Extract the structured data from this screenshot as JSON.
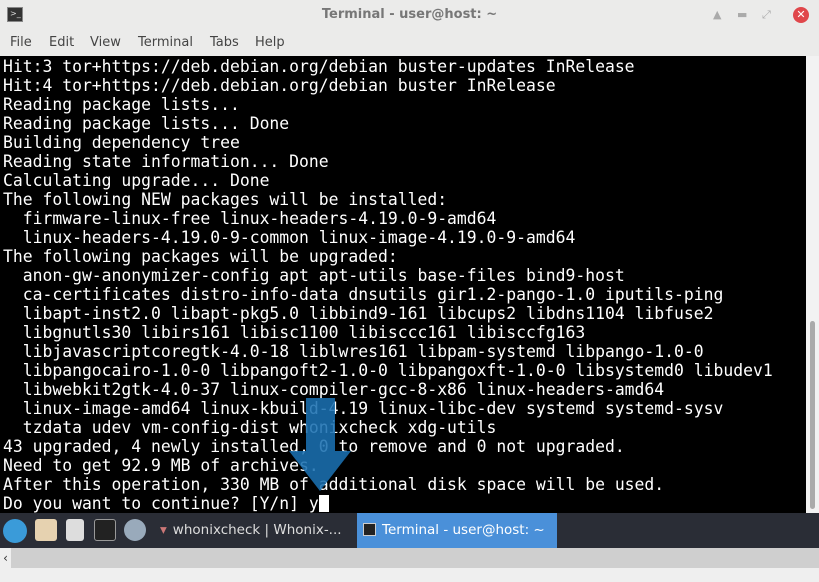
{
  "window": {
    "title": "Terminal - user@host: ~"
  },
  "menu": [
    "File",
    "Edit",
    "View",
    "Terminal",
    "Tabs",
    "Help"
  ],
  "terminal": {
    "lines": [
      "Hit:3 tor+https://deb.debian.org/debian buster-updates InRelease",
      "Hit:4 tor+https://deb.debian.org/debian buster InRelease",
      "Reading package lists...",
      "Reading package lists... Done",
      "Building dependency tree",
      "Reading state information... Done",
      "Calculating upgrade... Done",
      "The following NEW packages will be installed:",
      "  firmware-linux-free linux-headers-4.19.0-9-amd64",
      "  linux-headers-4.19.0-9-common linux-image-4.19.0-9-amd64",
      "The following packages will be upgraded:",
      "  anon-gw-anonymizer-config apt apt-utils base-files bind9-host",
      "  ca-certificates distro-info-data dnsutils gir1.2-pango-1.0 iputils-ping",
      "  libapt-inst2.0 libapt-pkg5.0 libbind9-161 libcups2 libdns1104 libfuse2",
      "  libgnutls30 libirs161 libisc1100 libisccc161 libisccfg163",
      "  libjavascriptcoregtk-4.0-18 liblwres161 libpam-systemd libpango-1.0-0",
      "  libpangocairo-1.0-0 libpangoft2-1.0-0 libpangoxft-1.0-0 libsystemd0 libudev1",
      "  libwebkit2gtk-4.0-37 linux-compiler-gcc-8-x86 linux-headers-amd64",
      "  linux-image-amd64 linux-kbuild-4.19 linux-libc-dev systemd systemd-sysv",
      "  tzdata udev vm-config-dist whonixcheck xdg-utils",
      "43 upgraded, 4 newly installed, 0 to remove and 0 not upgraded.",
      "Need to get 92.9 MB of archives.",
      "After this operation, 330 MB of additional disk space will be used."
    ],
    "prompt": "Do you want to continue? [Y/n] ",
    "input": "y"
  },
  "annotation": {
    "arrow_color": "#1a6fb0"
  },
  "taskbar": {
    "tasks": [
      {
        "label": "whonixcheck | Whonix-..."
      },
      {
        "label": "Terminal - user@host: ~",
        "active": true
      }
    ],
    "active_color": "#4a90d9"
  }
}
